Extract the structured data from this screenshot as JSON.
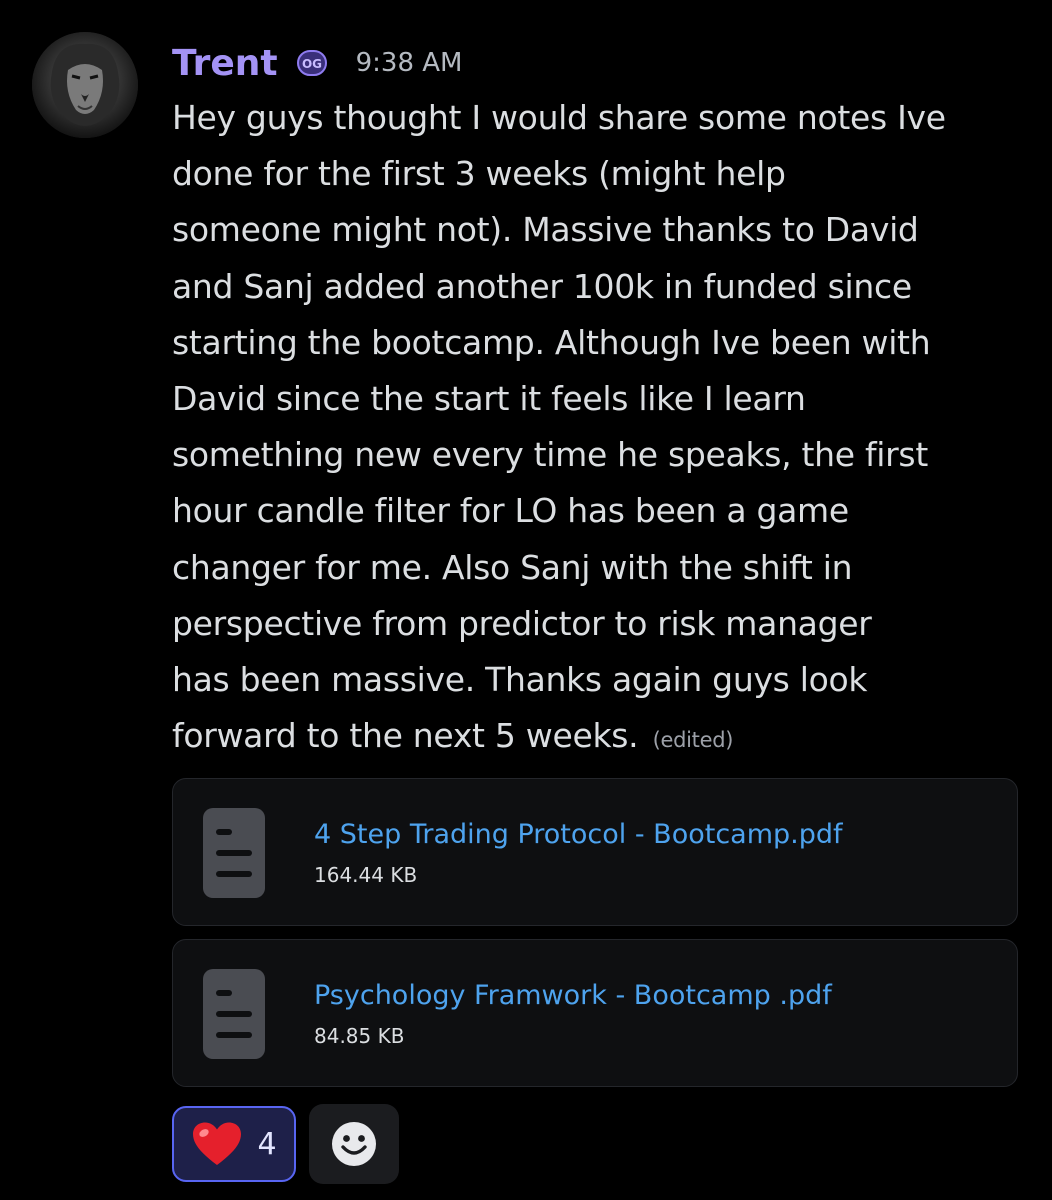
{
  "message": {
    "username": "Trent",
    "badge_text": "OG",
    "timestamp": "9:38 AM",
    "edited_label": "(edited)",
    "lines": [
      "Hey guys thought I would share some notes Ive",
      "done for the first 3 weeks (might help",
      "someone might not). Massive thanks to David",
      "and Sanj added another 100k in funded since",
      "starting the bootcamp. Although Ive been with",
      "David since the start it feels like I learn",
      "something new every time he speaks, the first",
      "hour candle filter for LO has been a game",
      "changer for me. Also Sanj with the shift in",
      "perspective from predictor to risk manager",
      "has been massive. Thanks again guys look",
      "forward to the next 5 weeks."
    ]
  },
  "attachments": [
    {
      "name": "4 Step Trading Protocol - Bootcamp.pdf",
      "size": "164.44 KB",
      "icon": "document-icon"
    },
    {
      "name": "Psychology Framwork - Bootcamp .pdf",
      "size": "84.85 KB",
      "icon": "document-icon"
    }
  ],
  "reactions": [
    {
      "emoji": "❤️",
      "count": "4",
      "icon": "heart-icon"
    }
  ],
  "add_reaction_icon": "smiley-icon",
  "colors": {
    "background": "#000000",
    "username": "#a493f5",
    "link": "#4ea3ee",
    "reaction_border": "#5865f2",
    "text": "#dbdee1"
  }
}
